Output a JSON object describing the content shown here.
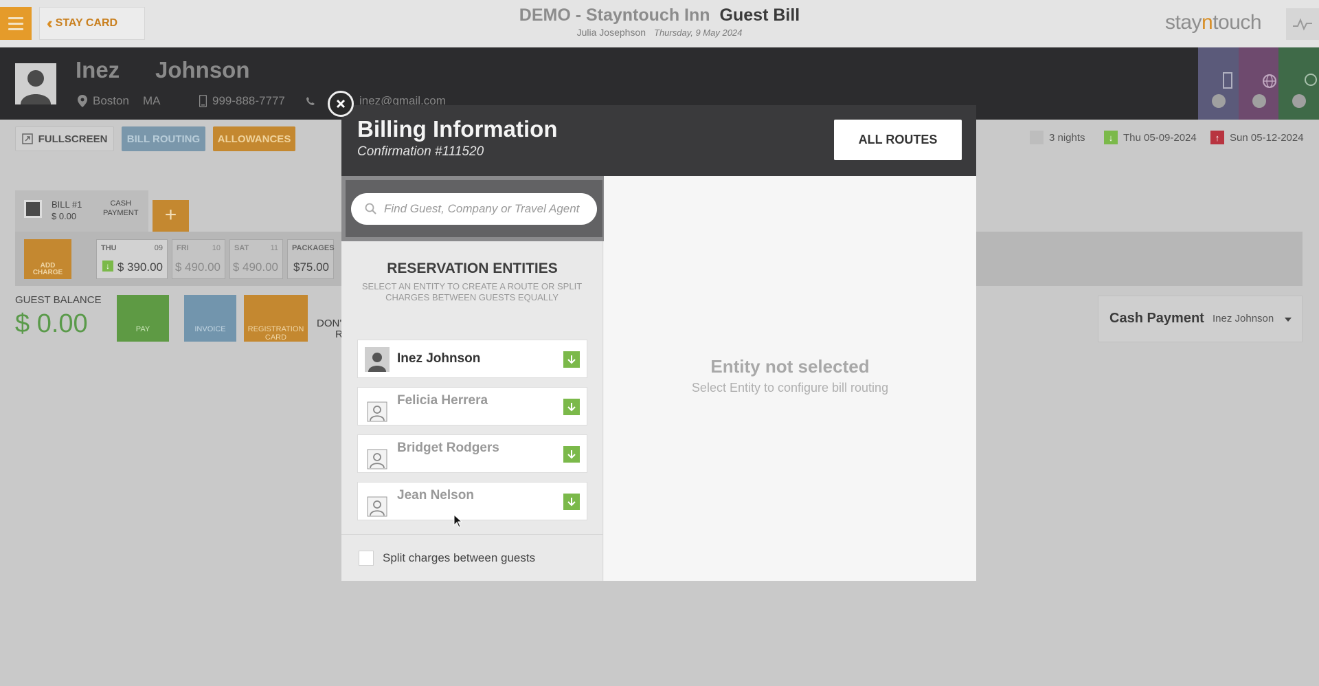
{
  "header": {
    "stay_card_label": "STAY CARD",
    "hotel_name": "DEMO - Stayntouch Inn",
    "page_name": "Guest Bill",
    "user_name": "Julia Josephson",
    "date": "Thursday, 9 May 2024",
    "brand_pre": "stay",
    "brand_n": "n",
    "brand_post": "touch"
  },
  "guest": {
    "first_name": "Inez",
    "last_name": "Johnson",
    "city": "Boston",
    "state": "MA",
    "mobile": "999-888-7777",
    "email": "inez@gmail.com"
  },
  "actions": {
    "fullscreen": "FULLSCREEN",
    "bill_routing": "BILL ROUTING",
    "allowances": "ALLOWANCES"
  },
  "stay": {
    "nights": "3 nights",
    "arrival": "Thu 05-09-2024",
    "departure": "Sun 05-12-2024"
  },
  "bill": {
    "label": "BILL #1",
    "amount": "$ 0.00",
    "payment_line1": "CASH",
    "payment_line2": "PAYMENT",
    "add_charge_line1": "ADD",
    "add_charge_line2": "CHARGE",
    "days": [
      {
        "label": "THU",
        "num": "09",
        "value": "$ 390.00"
      },
      {
        "label": "FRI",
        "num": "10",
        "value": "$ 490.00"
      },
      {
        "label": "SAT",
        "num": "11",
        "value": "$ 490.00"
      },
      {
        "label": "PACKAGES",
        "num": "",
        "value": "$75.00"
      }
    ],
    "guest_balance_label": "GUEST BALANCE",
    "guest_balance": "$ 0.00",
    "pay_label": "PAY",
    "invoice_label": "INVOICE",
    "registration_line1": "REGISTRATION",
    "registration_line2": "CARD",
    "dont_text1": "DON'",
    "dont_text2": "R",
    "cash_payment_title": "Cash Payment",
    "cash_payment_name": "Inez Johnson"
  },
  "modal": {
    "title": "Billing Information",
    "confirmation": "Confirmation #111520",
    "all_routes": "ALL ROUTES",
    "search_placeholder": "Find Guest, Company or Travel Agent",
    "entities_title": "RESERVATION ENTITIES",
    "entities_subtitle": "SELECT AN ENTITY TO CREATE A ROUTE OR SPLIT CHARGES BETWEEN GUESTS EQUALLY",
    "entities": [
      {
        "name": "Inez Johnson"
      },
      {
        "name": "Felicia Herrera"
      },
      {
        "name": "Bridget Rodgers"
      },
      {
        "name": "Jean Nelson"
      }
    ],
    "split_label": "Split charges between guests",
    "empty_title": "Entity not selected",
    "empty_subtitle": "Select Entity to configure bill routing"
  },
  "colors": {
    "accent_orange": "#e59b2a",
    "success_green": "#7bb94a",
    "header_dark": "#3a3a3c"
  }
}
